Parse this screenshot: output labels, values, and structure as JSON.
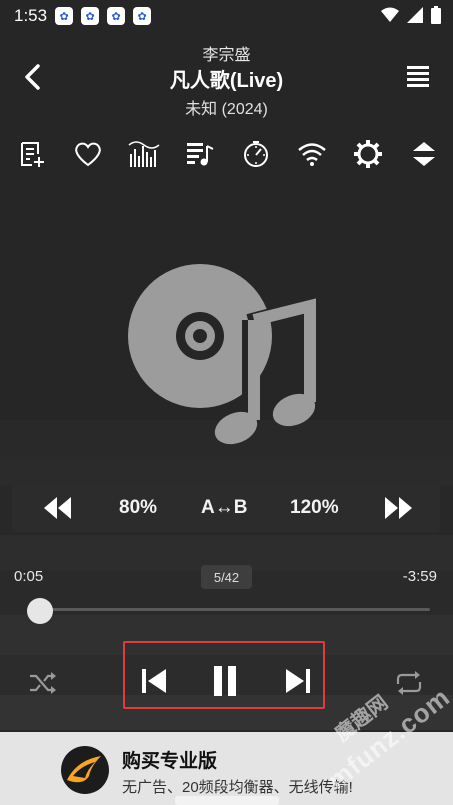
{
  "status_bar": {
    "time": "1:53",
    "notification_count": 4,
    "notification_icon": "baidu-paw-icon"
  },
  "header": {
    "artist": "李宗盛",
    "title": "凡人歌(Live)",
    "album": "未知 (2024)"
  },
  "toolbar": {
    "icons": [
      "add-to-playlist-icon",
      "heart-icon",
      "equalizer-icon",
      "queue-music-icon",
      "sleep-timer-icon",
      "wifi-transfer-icon",
      "settings-gear-icon",
      "expand-collapse-icon"
    ]
  },
  "speed_bar": {
    "rewind_icon": "fast-rewind-icon",
    "slow_label": "80%",
    "ab_label": "A↔B",
    "fast_label": "120%",
    "forward_icon": "fast-forward-icon"
  },
  "progress": {
    "current_time": "0:05",
    "remaining_time": "-3:59",
    "track_position": "5/42",
    "fraction": 0.02
  },
  "controls": {
    "shuffle_icon": "shuffle-icon",
    "prev_icon": "skip-previous-icon",
    "pause_icon": "pause-icon",
    "next_icon": "skip-next-icon",
    "repeat_icon": "repeat-icon",
    "highlight_color": "#e23b3b"
  },
  "promo": {
    "title": "购买专业版",
    "subtitle": "无广告、20频段均衡器、无线传输!"
  },
  "watermark": {
    "line1": "魔趣网",
    "line2": "mfunz.com"
  },
  "colors": {
    "background": "#262626",
    "promo_bg": "#e4e4e4",
    "icon": "#ffffff"
  }
}
